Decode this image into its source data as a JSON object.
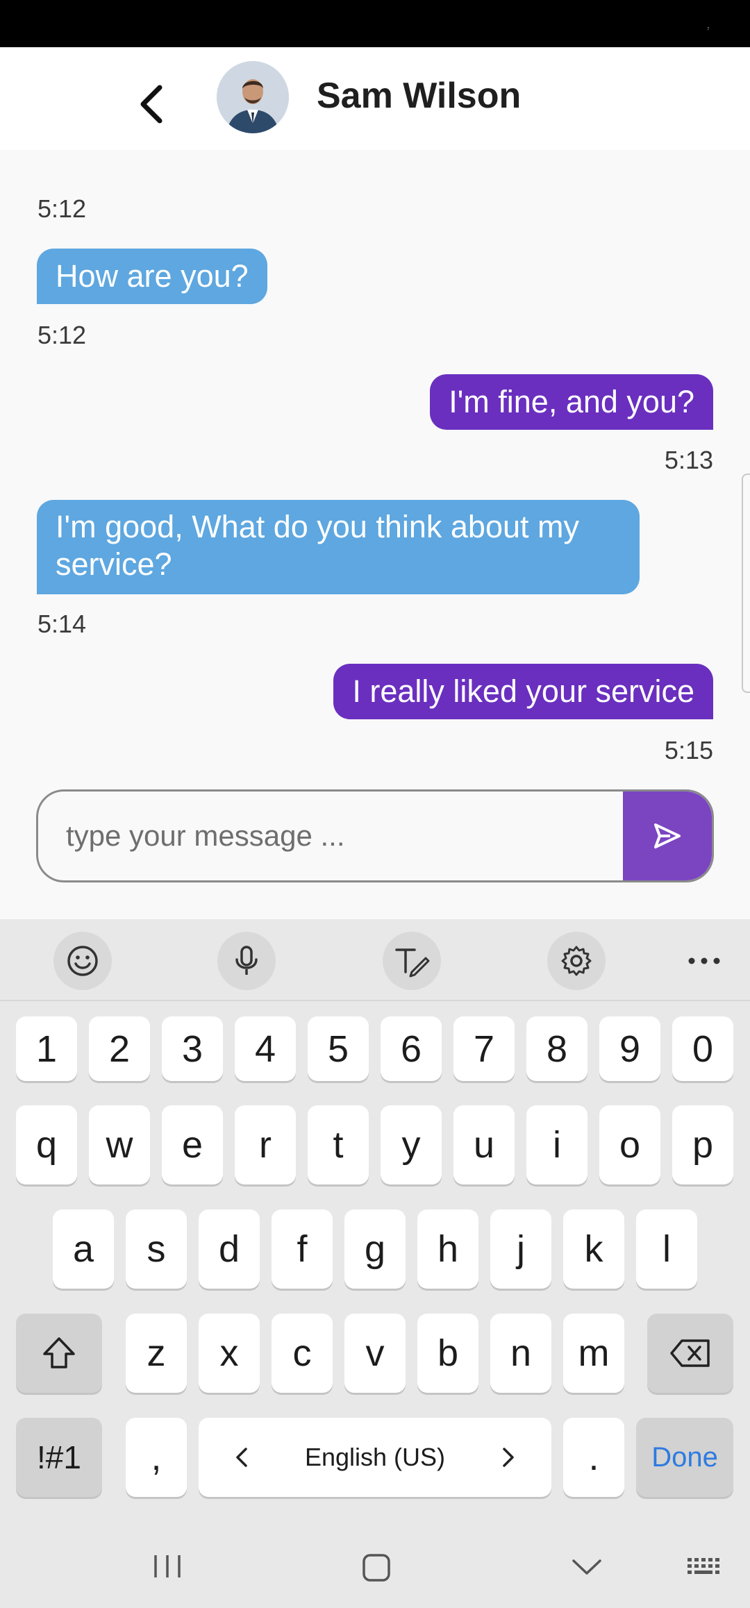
{
  "contact": {
    "name": "Sam Wilson"
  },
  "messages": [
    {
      "time": "5:12"
    },
    {
      "text": "How are you?",
      "time": "5:12",
      "direction": "incoming"
    },
    {
      "text": "I'm fine, and you?",
      "time": "5:13",
      "direction": "outgoing"
    },
    {
      "text": "I'm good, What do you think about my service?",
      "time": "5:14",
      "direction": "incoming"
    },
    {
      "text": "I really liked your service",
      "time": "5:15",
      "direction": "outgoing"
    }
  ],
  "composer": {
    "placeholder": "type your message ..."
  },
  "colors": {
    "incoming_bubble": "#5ea7e0",
    "outgoing_bubble": "#6a2fbf",
    "send_button": "#7b45c2",
    "done_key": "#2d7be0"
  },
  "keyboard": {
    "number_row": [
      "1",
      "2",
      "3",
      "4",
      "5",
      "6",
      "7",
      "8",
      "9",
      "0"
    ],
    "row1": [
      "q",
      "w",
      "e",
      "r",
      "t",
      "y",
      "u",
      "i",
      "o",
      "p"
    ],
    "row2": [
      "a",
      "s",
      "d",
      "f",
      "g",
      "h",
      "j",
      "k",
      "l"
    ],
    "row3": [
      "z",
      "x",
      "c",
      "v",
      "b",
      "n",
      "m"
    ],
    "symbols_key": "!#1",
    "comma_key": ",",
    "period_key": ".",
    "space_label": "English (US)",
    "done_key": "Done",
    "toolbar_icons": [
      "emoji-icon",
      "microphone-icon",
      "handwriting-icon",
      "settings-icon",
      "more-icon"
    ]
  },
  "navbar_icons": [
    "recents-icon",
    "home-icon",
    "back-icon",
    "keyboard-toggle-icon"
  ]
}
